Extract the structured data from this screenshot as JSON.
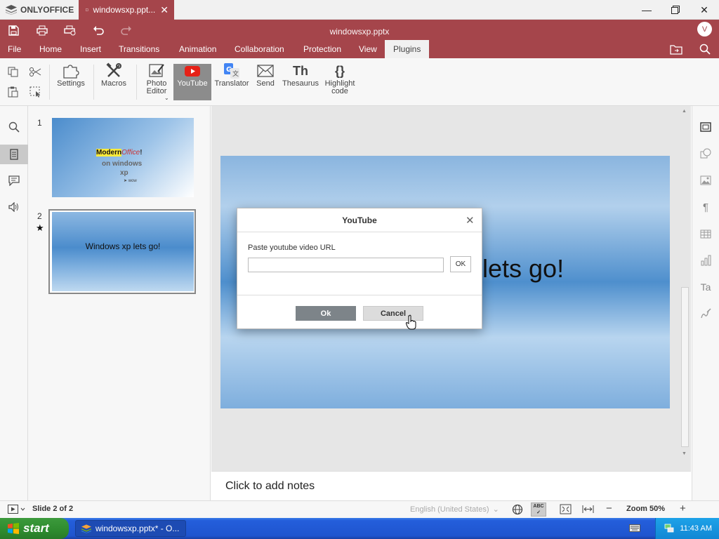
{
  "app": {
    "brand": "ONLYOFFICE",
    "tab_title": "windowsxp.ppt...",
    "doc_title": "windowsxp.pptx",
    "avatar_initial": "V",
    "accent": "#a5454b"
  },
  "menu": {
    "items": [
      "File",
      "Home",
      "Insert",
      "Transitions",
      "Animation",
      "Collaboration",
      "Protection",
      "View",
      "Plugins"
    ],
    "active": "Plugins"
  },
  "toolbar": {
    "settings": "Settings",
    "macros": "Macros",
    "photo_editor": "Photo Editor",
    "youtube": "YouTube",
    "translator": "Translator",
    "send": "Send",
    "thesaurus": "Thesaurus",
    "highlight_code": "Highlight code"
  },
  "thumbnails": [
    {
      "number": "1",
      "line1a": "Modern",
      "line1b": "Office",
      "line1c": "!",
      "line2": "on windows",
      "line3": "xp",
      "bullet": "wow"
    },
    {
      "number": "2",
      "text": "Windows xp lets go!"
    }
  ],
  "slide": {
    "visible_text": "lets go!"
  },
  "notes": {
    "placeholder": "Click to add notes"
  },
  "status": {
    "slide_info": "Slide 2 of 2",
    "language": "English (United States)",
    "zoom": "Zoom 50%"
  },
  "dialog": {
    "title": "YouTube",
    "label": "Paste youtube video URL",
    "input_value": "",
    "inline_ok": "OK",
    "ok": "Ok",
    "cancel": "Cancel"
  },
  "taskbar": {
    "start": "start",
    "task": "windowsxp.pptx* - O...",
    "clock": "11:43 AM"
  }
}
